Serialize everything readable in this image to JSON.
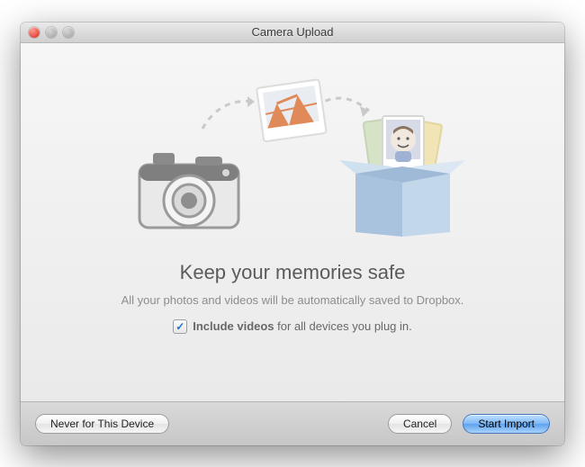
{
  "window": {
    "title": "Camera Upload"
  },
  "main": {
    "headline": "Keep your memories safe",
    "subtext": "All your photos and videos will be automatically saved to Dropbox."
  },
  "checkbox": {
    "checked": true,
    "label_bold": "Include videos",
    "label_rest": " for all devices you plug in."
  },
  "buttons": {
    "never": "Never for This Device",
    "cancel": "Cancel",
    "start": "Start Import"
  }
}
